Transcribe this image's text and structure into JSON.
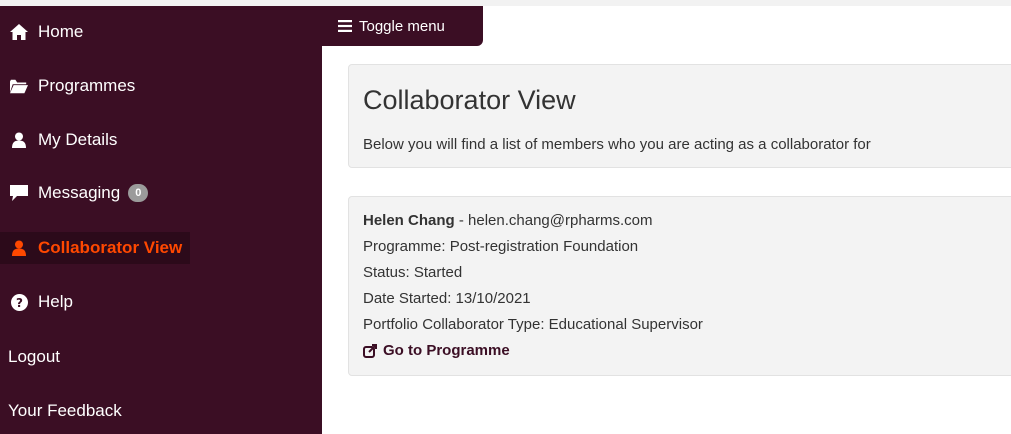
{
  "sidebar": {
    "items": [
      {
        "label": "Home",
        "icon": "home-icon"
      },
      {
        "label": "Programmes",
        "icon": "folder-open-icon"
      },
      {
        "label": "My Details",
        "icon": "user-icon"
      },
      {
        "label": "Messaging",
        "icon": "comment-icon",
        "badge": "0"
      },
      {
        "label": "Collaborator View",
        "icon": "user-icon",
        "active": true
      },
      {
        "label": "Help",
        "icon": "question-circle-icon"
      },
      {
        "label": "Logout"
      },
      {
        "label": "Your Feedback"
      }
    ]
  },
  "toggle": {
    "label": "Toggle menu",
    "icon": "bars-icon"
  },
  "page": {
    "title": "Collaborator View",
    "subtitle": "Below you will find a list of members who you are acting as a collaborator for"
  },
  "member": {
    "name": "Helen Chang",
    "email": " - helen.chang@rpharms.com",
    "programme": "Programme: Post-registration Foundation",
    "status": "Status: Started",
    "date_started": "Date Started: 13/10/2021",
    "collaborator_type": "Portfolio Collaborator Type: Educational Supervisor",
    "link_label": "Go to Programme",
    "link_icon": "external-link-icon"
  },
  "colors": {
    "sidebar": "#3b0e24",
    "active": "#ff4800",
    "badge": "#9b9b9b"
  }
}
